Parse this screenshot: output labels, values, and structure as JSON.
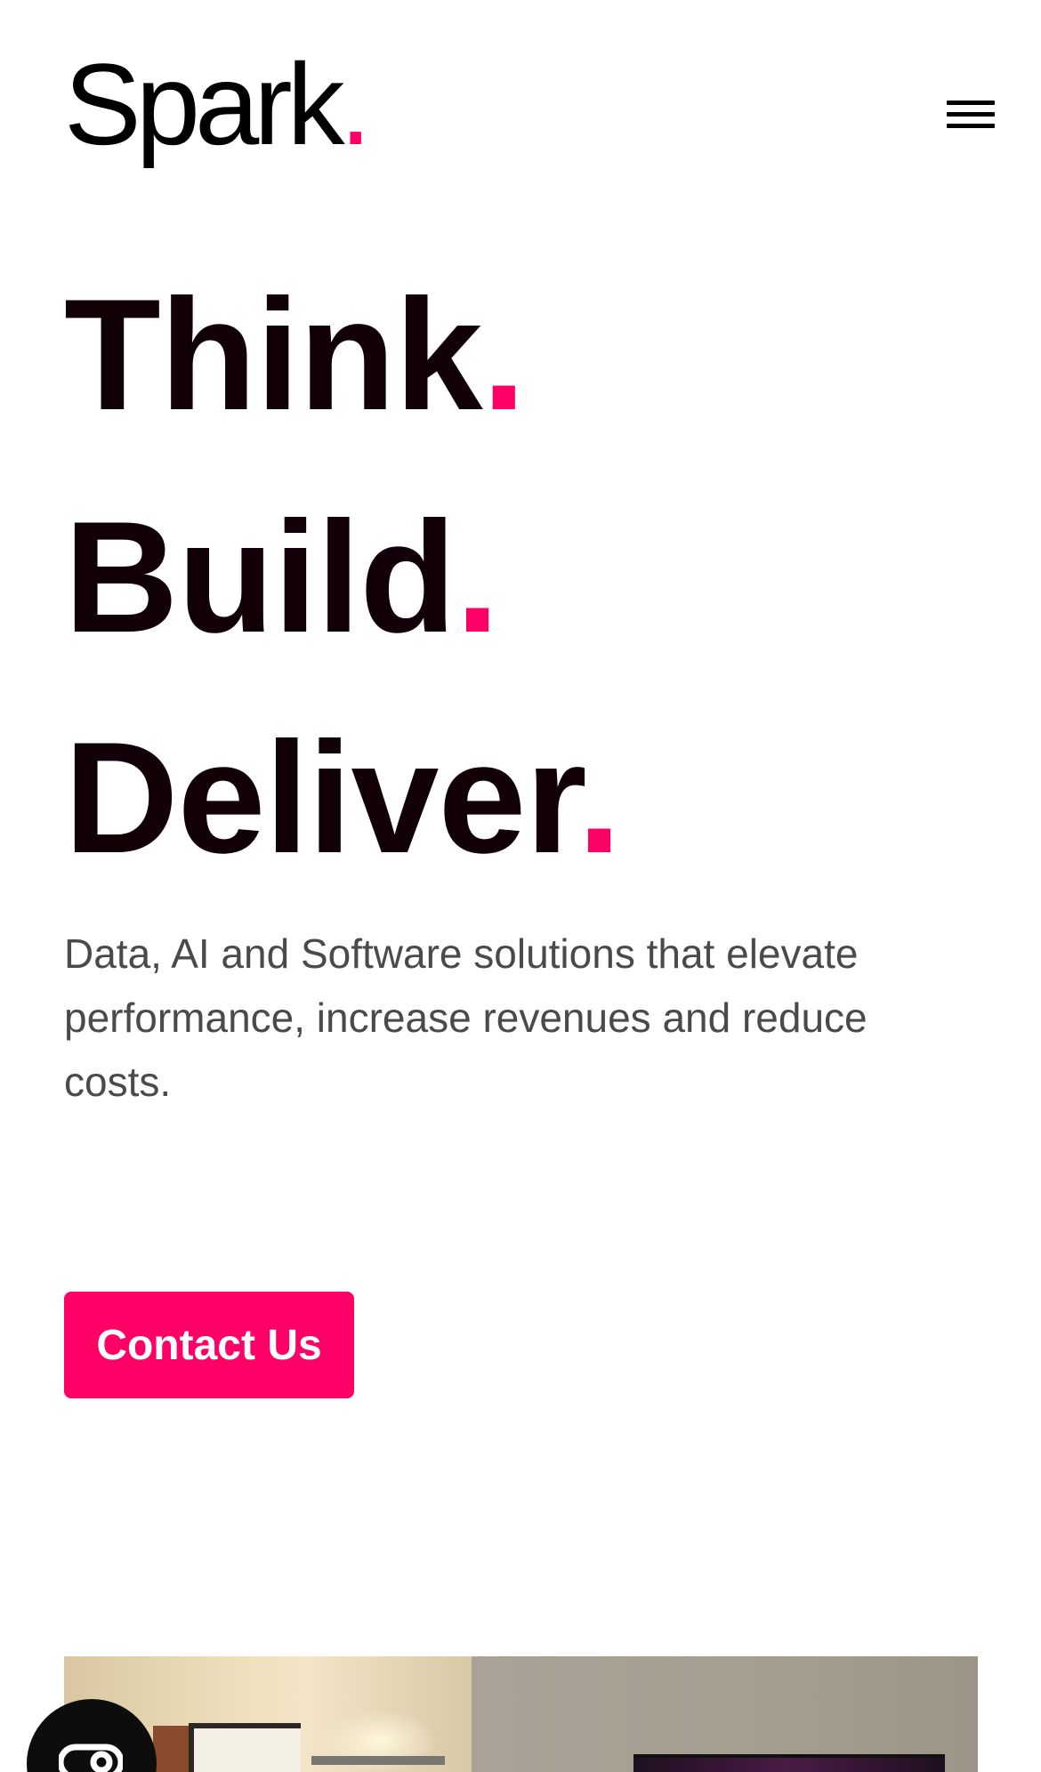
{
  "header": {
    "logo_text": "Spark",
    "logo_dot": ".",
    "menu_icon": "hamburger-menu-icon"
  },
  "hero": {
    "headline": [
      {
        "word": "Think",
        "dot": "."
      },
      {
        "word": "Build",
        "dot": "."
      },
      {
        "word": "Deliver",
        "dot": "."
      }
    ],
    "subtitle": "Data, AI and Software solutions that elevate performance, increase revenues and reduce costs.",
    "cta_label": "Contact Us"
  },
  "chat_widget": {
    "icon": "chat-bubble-icon"
  },
  "colors": {
    "accent": "#ff0066",
    "headline": "#120008",
    "body_text": "#4a4a4a",
    "background": "#ffffff"
  }
}
